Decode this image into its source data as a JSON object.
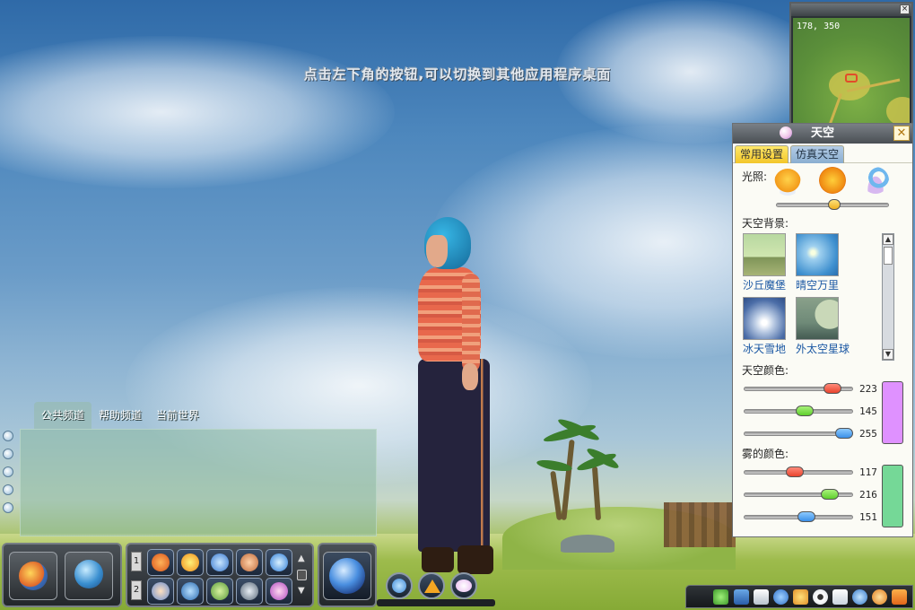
{
  "hint_text": "点击左下角的按钮,可以切换到其他应用程序桌面",
  "minimap": {
    "coords": "178, 350",
    "close_glyph": "×"
  },
  "sky_panel": {
    "title": "天空",
    "close_glyph": "✕",
    "tabs": [
      {
        "label": "常用设置",
        "active": true
      },
      {
        "label": "仿真天空",
        "active": false
      }
    ],
    "lighting": {
      "label": "光照:",
      "icons": [
        "sun-cloud-icon",
        "sun-face-icon",
        "moon-night-icon"
      ],
      "level": 0.52
    },
    "background": {
      "label": "天空背景:",
      "items": [
        {
          "name": "沙丘魔堡",
          "icon": "dune-castle-thumbnail"
        },
        {
          "name": "晴空万里",
          "icon": "clear-sky-thumbnail"
        },
        {
          "name": "冰天雪地",
          "icon": "snowfield-thumbnail"
        },
        {
          "name": "外太空星球",
          "icon": "outer-space-planet-thumbnail"
        }
      ],
      "scroll_up": "▲",
      "scroll_down": "▼"
    },
    "sky_color": {
      "label": "天空颜色:",
      "r": "223",
      "g": "145",
      "b": "255",
      "swatch": "#df91ff"
    },
    "fog_color": {
      "label": "雾的颜色:",
      "r": "117",
      "g": "216",
      "b": "151",
      "swatch": "#75d897"
    }
  },
  "chat": {
    "tabs": [
      {
        "label": "公共频道",
        "active": true
      },
      {
        "label": "帮助频道",
        "active": false
      },
      {
        "label": "当前世界",
        "active": false
      }
    ],
    "side_buttons": [
      "speech-bubble-icon",
      "scroll-up-icon",
      "scroll-down-icon",
      "scroll-end-icon",
      "lock-icon"
    ]
  },
  "hotbar": {
    "row_numbers": [
      "1",
      "2"
    ],
    "row1_icons": [
      "rocket-icon",
      "star-burst-icon",
      "swirl-icon",
      "people-icon",
      "chat-dots-icon"
    ],
    "row2_icons": [
      "avatar-card-icon",
      "whale-icon",
      "terrain-icon",
      "camera-icon",
      "magnify-icon"
    ],
    "page_up": "▲",
    "page_down": "▼",
    "main_buttons": [
      "app-switch-icon",
      "globe-icon"
    ],
    "special_button": "magic-orb-icon",
    "quick_buttons": [
      "refresh-icon",
      "triangle-icon",
      "sky-icon"
    ]
  },
  "tray": {
    "icons": [
      "bug-icon",
      "save-icon",
      "document-icon",
      "help-icon",
      "bird-icon",
      "eye-icon",
      "home-icon",
      "network-icon",
      "broadcast-icon",
      "rss-icon"
    ]
  },
  "colors": {
    "sky_color_swatch": "#df91ff",
    "fog_color_swatch": "#75d897",
    "tab_active": "#f2c629",
    "tab_inactive": "#8aaed0",
    "thumb_red": "#e8432d",
    "thumb_green": "#5fcf2d",
    "thumb_blue": "#3b8fe8",
    "thumb_orange": "#f0b020"
  }
}
